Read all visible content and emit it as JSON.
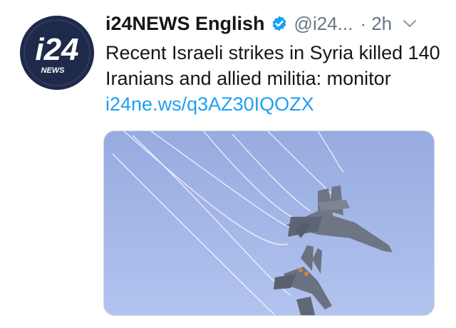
{
  "tweet": {
    "avatar": {
      "icon": "i24news-logo-icon",
      "logo_text": "i24",
      "logo_subtext": "NEWS"
    },
    "display_name": "i24NEWS English",
    "verified_icon": "verified-badge-icon",
    "handle": "@i24...",
    "timestamp": "· 2h",
    "menu_icon": "chevron-down-icon",
    "text": "Recent Israeli strikes in Syria killed 140 Iranians and allied militia: monitor",
    "link_text": "i24ne.ws/q3AZ30IQOZX",
    "media": {
      "icon": "fighter-jets-photo"
    }
  },
  "colors": {
    "text": "#14171a",
    "secondary": "#657786",
    "link": "#1da1f2",
    "sky": "#a5b8e8",
    "logo_bg": "#1f2a4a"
  }
}
